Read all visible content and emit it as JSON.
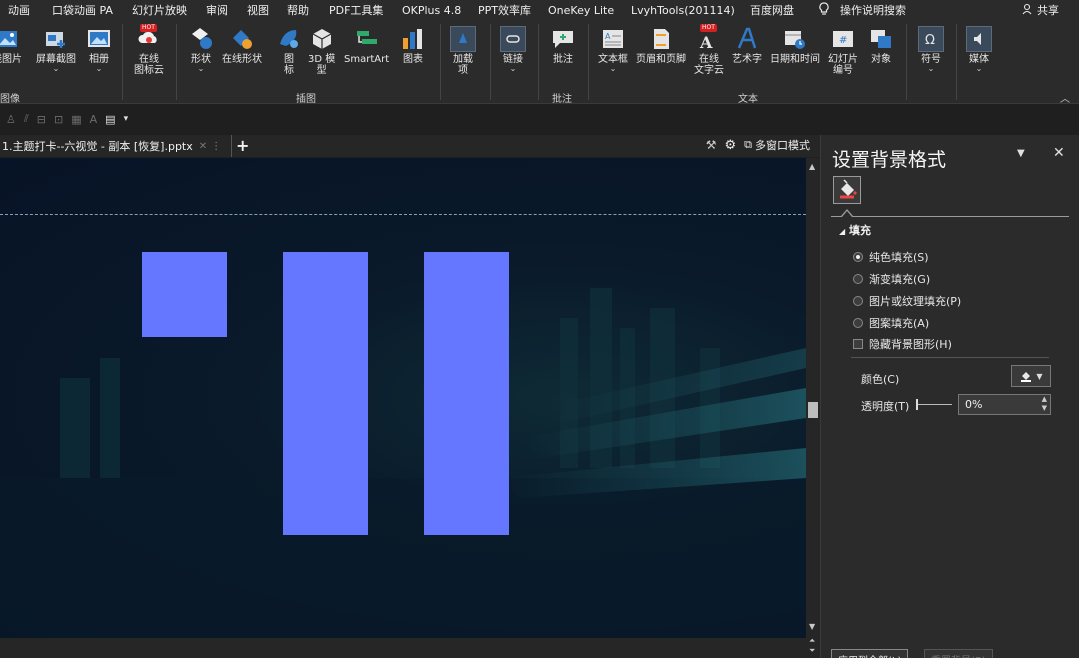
{
  "menu": {
    "items": [
      "动画",
      "口袋动画 PA",
      "幻灯片放映",
      "审阅",
      "视图",
      "帮助",
      "PDF工具集",
      "OKPlus 4.8",
      "PPT效率库",
      "OneKey Lite",
      "LvyhTools(201114)",
      "百度网盘",
      "操作说明搜索"
    ],
    "share": "共享"
  },
  "ribbon": {
    "groups": {
      "image": "图像",
      "illustration": "插图",
      "comment": "批注",
      "text": "文本"
    },
    "buttons": {
      "album_pic": "线图片",
      "screenshot": "屏幕截图",
      "album": "相册",
      "online_icon_line1": "在线",
      "online_icon_line2": "图标云",
      "shape": "形状",
      "online_shape": "在线形状",
      "icon_line1": "图",
      "icon_line2": "标",
      "model3d_line1": "3D 模",
      "model3d_line2": "型",
      "smartart": "SmartArt",
      "chart": "图表",
      "addin_line1": "加载",
      "addin_line2": "项",
      "link": "链接",
      "comment": "批注",
      "textbox": "文本框",
      "header_footer": "页眉和页脚",
      "online_text_line1": "在线",
      "online_text_line2": "文字云",
      "wordart": "艺术字",
      "datetime": "日期和时间",
      "slide_num_line1": "幻灯片",
      "slide_num_line2": "编号",
      "object": "对象",
      "symbol": "符号",
      "media": "媒体",
      "hot": "HOT"
    }
  },
  "doc_tab": {
    "title": "1.主题打卡--六视觉 - 副本 [恢复].pptx",
    "multi_window": "多窗口模式"
  },
  "pane": {
    "title": "设置背景格式",
    "section_fill": "填充",
    "options": [
      "纯色填充(S)",
      "渐变填充(G)",
      "图片或纹理填充(P)",
      "图案填充(A)"
    ],
    "selected_option": 0,
    "hide_bg": "隐藏背景图形(H)",
    "color_label": "颜色(C)",
    "transparency_label": "透明度(T)",
    "transparency_value": "0%",
    "apply_all": "应用到全部(L)",
    "reset_bg": "重置背景(B)"
  },
  "colors": {
    "accent_rect": "#6577ff",
    "slide_bg": "#071326"
  }
}
